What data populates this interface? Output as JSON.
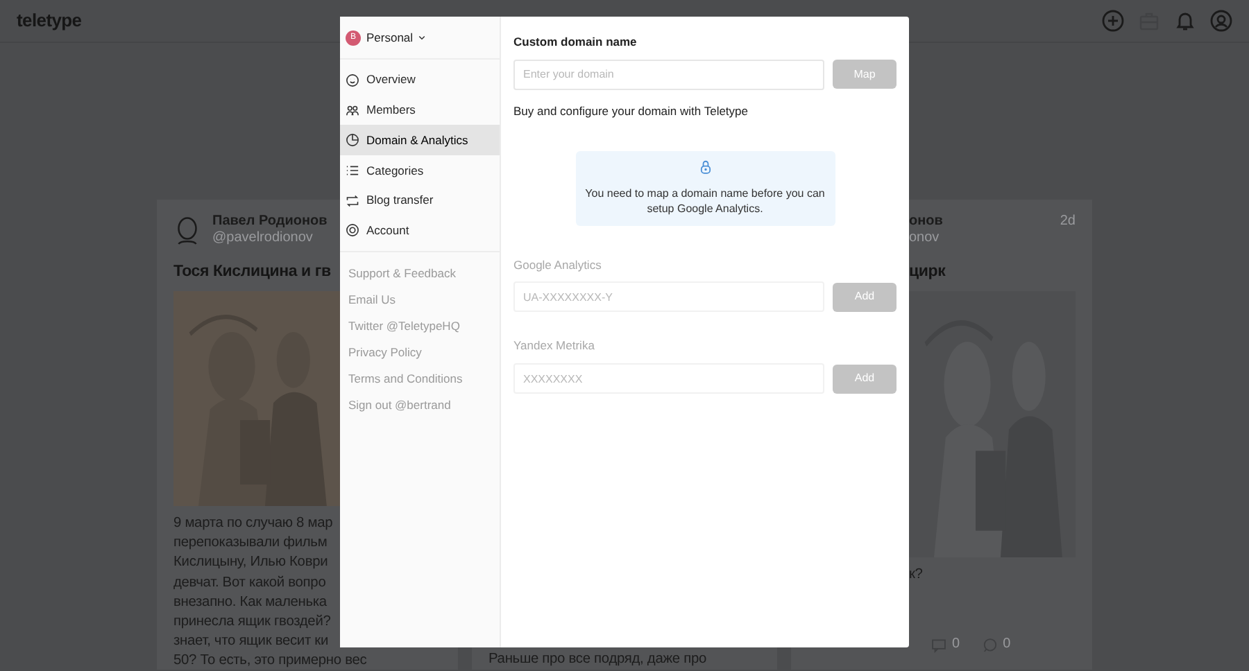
{
  "app_bar": {
    "logo": "teletype"
  },
  "feed": {
    "cards": [
      {
        "author": "Павел Родионов",
        "handle": "@pavelrodionov",
        "title": "Тося Кислицина и гв",
        "picture": {
          "kind": "picture"
        },
        "lines": [
          "9 марта по случаю 8 мар",
          "перепоказывали фильм",
          "Кислицыну, Илью Коври",
          "девчат. Вот какой вопро",
          "внезапно. Как маленька",
          "принесла ящик гвоздей?",
          "знает, что ящик весит ки",
          "50? То есть, это примерно вес"
        ]
      },
      {
        "lines": [
          "Раньше про все подряд, даже про"
        ]
      },
      {
        "author": "онов",
        "handle": "onov",
        "time": "2d",
        "title": "цирк",
        "picture": {
          "kind": "picture"
        },
        "lines": [
          "к?"
        ],
        "counters": [
          "0",
          "0"
        ]
      }
    ]
  },
  "modal": {
    "account": {
      "initial": "B",
      "name": "Personal"
    },
    "nav": [
      {
        "label": "Overview",
        "selected": false
      },
      {
        "label": "Members",
        "selected": false
      },
      {
        "label": "Domain & Analytics",
        "selected": true
      },
      {
        "label": "Categories",
        "selected": false
      },
      {
        "label": "Blog transfer",
        "selected": false
      },
      {
        "label": "Account",
        "selected": false
      }
    ],
    "links": [
      "Support & Feedback",
      "Email Us",
      "Twitter @TeletypeHQ",
      "Privacy Policy",
      "Terms and Conditions",
      "Sign out @bertrand"
    ],
    "domain": {
      "label": "Custom domain name",
      "placeholder": "Enter your domain",
      "button": "Map",
      "disabled": false,
      "button_disabled": true,
      "hint": "Buy and configure your domain with Teletype"
    },
    "notice": "You need to map a domain name before you can setup Google Analytics.",
    "analytics": [
      {
        "label": "Google Analytics",
        "placeholder": "UA-XXXXXXXX-Y",
        "button": "Add",
        "disabled": true
      },
      {
        "label": "Yandex Metrika",
        "placeholder": "XXXXXXXX",
        "button": "Add",
        "disabled": true
      }
    ]
  }
}
